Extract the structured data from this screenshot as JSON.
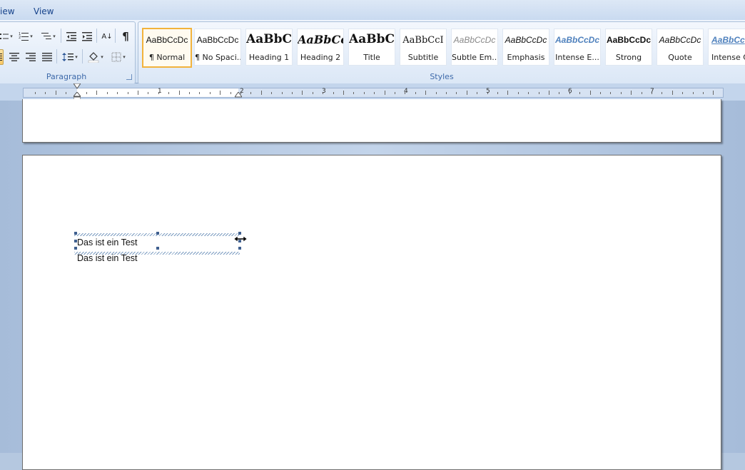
{
  "tabs": {
    "view_partial": "iew",
    "view": "View"
  },
  "paragraph": {
    "label": "Paragraph",
    "pilcrow": "¶",
    "sort": "A↓"
  },
  "styles": {
    "label": "Styles",
    "items": [
      {
        "sample": "AaBbCcDc",
        "name": "¶ Normal"
      },
      {
        "sample": "AaBbCcDc",
        "name": "¶ No Spaci..."
      },
      {
        "sample": "AaBbC",
        "name": "Heading 1"
      },
      {
        "sample": "AaBbCc",
        "name": "Heading 2"
      },
      {
        "sample": "AaBbC",
        "name": "Title"
      },
      {
        "sample": "AaBbCcI",
        "name": "Subtitle"
      },
      {
        "sample": "AaBbCcDc",
        "name": "Subtle Em..."
      },
      {
        "sample": "AaBbCcDc",
        "name": "Emphasis"
      },
      {
        "sample": "AaBbCcDc",
        "name": "Intense E..."
      },
      {
        "sample": "AaBbCcDc",
        "name": "Strong"
      },
      {
        "sample": "AaBbCcDc",
        "name": "Quote"
      },
      {
        "sample": "AaBbCc",
        "name": "Intense Q"
      }
    ]
  },
  "ruler": {
    "numbers": [
      "1",
      "2",
      "3",
      "4",
      "5",
      "6",
      "7"
    ]
  },
  "document": {
    "textbox_text": "Das ist ein Test",
    "body_text": "Das ist ein Test"
  },
  "colors": {
    "selected_style_border": "#f2b33c",
    "ribbon_label": "#3e6aaa"
  }
}
